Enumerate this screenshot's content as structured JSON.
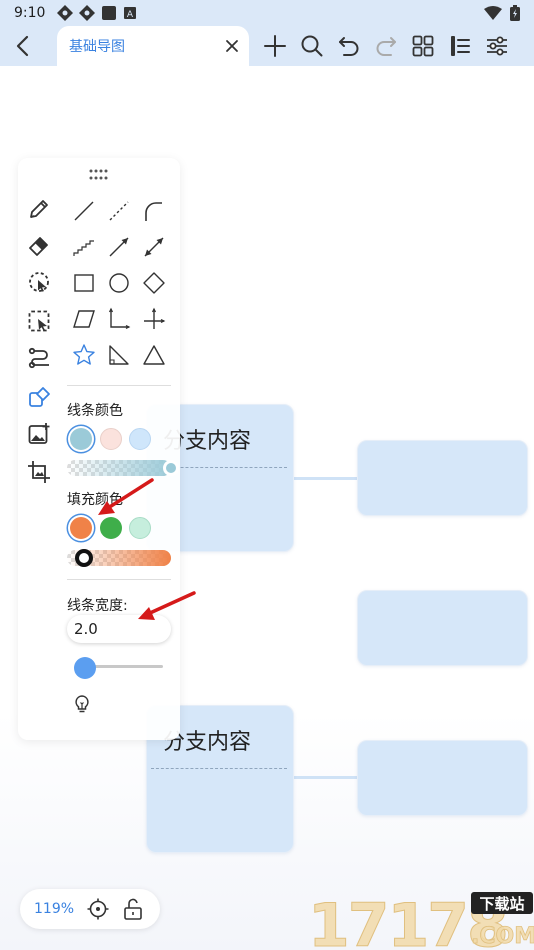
{
  "status_bar": {
    "time": "9:10",
    "left_icons": [
      "sync-icon",
      "sync-icon",
      "square-icon",
      "a-icon"
    ],
    "right_icons": [
      "wifi-icon",
      "battery-icon"
    ]
  },
  "header": {
    "tab_title": "基础导图",
    "toolbar_icons": [
      "plus-icon",
      "search-icon",
      "undo-icon",
      "redo-icon",
      "grid-icon",
      "outline-icon",
      "settings-sliders-icon"
    ]
  },
  "canvas": {
    "nodes": [
      {
        "title": "分支内容"
      },
      {
        "title": "分支内容"
      }
    ]
  },
  "panel": {
    "line_color_label": "线条颜色",
    "fill_color_label": "填充颜色",
    "line_width_label": "线条宽度:",
    "line_width_value": "2.0",
    "line_colors": [
      "#9bcad8",
      "#fbe2dd",
      "#cfe6fb"
    ],
    "fill_colors": [
      "#f08248",
      "#3fae4a",
      "#c6eedd"
    ],
    "accent": "#4a8fe0"
  },
  "zoom": {
    "level": "119%"
  },
  "watermark": {
    "number": "17178",
    "tag": "下载站",
    "domain": ".COM"
  }
}
